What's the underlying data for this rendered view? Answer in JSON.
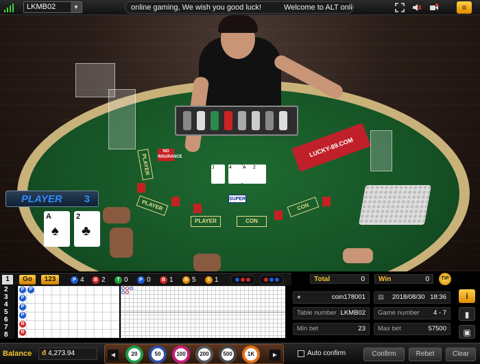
{
  "topbar": {
    "table_code": "LKMB02",
    "marquee_parts": [
      "online gaming, We wish you good luck!",
      "Welcome to ALT online gamir"
    ],
    "icons": [
      "fullscreen-icon",
      "sound-off-icon",
      "video-icon",
      "menu-icon"
    ]
  },
  "video": {
    "shoe_text": "LUCKY-89.COM",
    "no_insurance_text": "NO INSURANCE",
    "super_text": "SUPER",
    "table_labels": [
      "PLAYER",
      "CON",
      "PLAYER",
      "CON",
      "PLAYER"
    ]
  },
  "player_panel": {
    "label": "PLAYER",
    "score": "3",
    "cards": [
      {
        "rank": "A",
        "suit": "♠"
      },
      {
        "rank": "2",
        "suit": "♣"
      }
    ]
  },
  "stats": {
    "row_number": "1",
    "go_label": "Go",
    "num_label": "123",
    "counts": [
      {
        "letter": "P",
        "value": "4",
        "color": "#1e5bd6"
      },
      {
        "letter": "B",
        "value": "2",
        "color": "#d12a2a"
      },
      {
        "letter": "T",
        "value": "0",
        "color": "#1e9a3a"
      },
      {
        "letter": "P",
        "value": "0",
        "color": "#1e5bd6"
      },
      {
        "letter": "B",
        "value": "1",
        "color": "#d12a2a"
      },
      {
        "letter": "B",
        "value": "5",
        "color": "#e08a00"
      },
      {
        "letter": "S",
        "value": "1",
        "color": "#e08a00"
      }
    ],
    "total_label": "Total",
    "total_value": "0",
    "win_label": "Win",
    "win_value": "0",
    "tip_label": "TIP"
  },
  "road": {
    "row_numbers": [
      "2",
      "3",
      "4",
      "5",
      "6",
      "7",
      "8"
    ],
    "bead_sequence": [
      "P",
      "P",
      "P",
      "P",
      "B",
      "B",
      "P"
    ]
  },
  "info": {
    "user": "coin178001",
    "date": "2018/08/30",
    "time": "18:36",
    "table_number_label": "Table number",
    "table_number": "LKMB02",
    "game_number_label": "Game number",
    "game_number": "4 - 7",
    "min_bet_label": "Min bet",
    "min_bet": "23",
    "max_bet_label": "Max bet",
    "max_bet": "57500"
  },
  "bottom": {
    "balance_label": "Balance",
    "balance_value": "4,273.94",
    "chips": [
      {
        "value": "20",
        "color": "#1e9a4a"
      },
      {
        "value": "50",
        "color": "#2c4fa8"
      },
      {
        "value": "100",
        "color": "#c2207a"
      },
      {
        "value": "200",
        "color": "#555555"
      },
      {
        "value": "500",
        "color": "#444444"
      },
      {
        "value": "1K",
        "color": "#e0701a"
      }
    ],
    "auto_confirm": "Auto confirm",
    "confirm": "Confirm",
    "rebet": "Rebet",
    "clear": "Clear"
  },
  "colors": {
    "accent": "#f4c12f",
    "player": "#2f8bff",
    "banker": "#d12a2a"
  }
}
